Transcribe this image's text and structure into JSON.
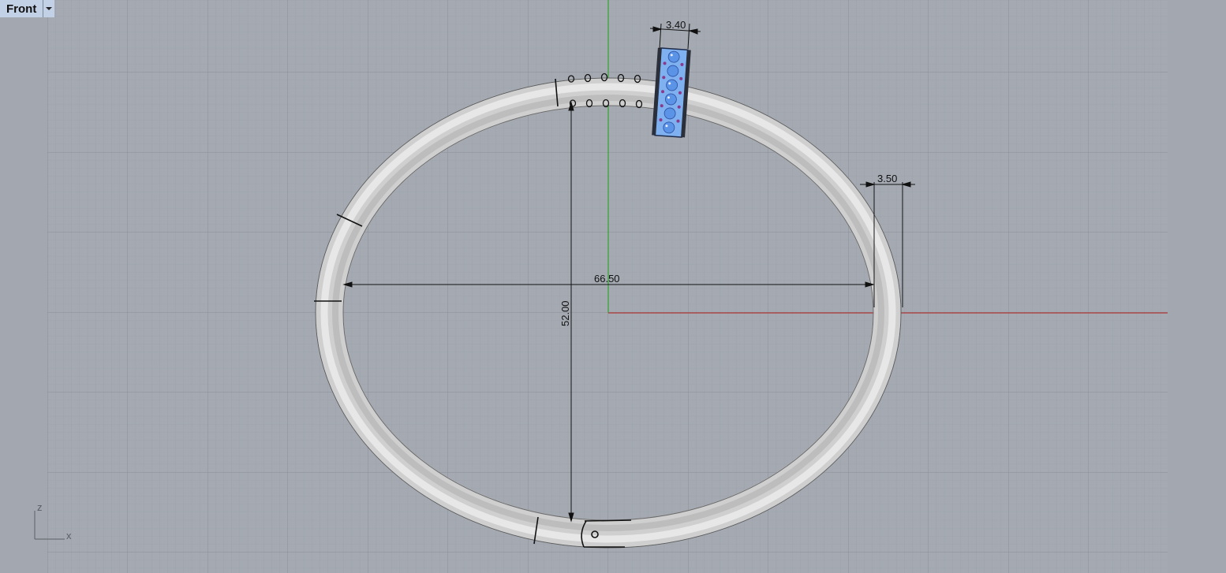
{
  "viewport": {
    "name": "Front",
    "background_color": "#a3a8b0",
    "grid_minor_color": "#989da5",
    "grid_major_color": "#8c9199",
    "x_axis_color": "#b03a3a",
    "z_axis_color": "#2fa52f"
  },
  "dimensions": {
    "width_label": "66.50",
    "height_label": "52.00",
    "thickness_label": "3.50",
    "stone_width_label": "3.40"
  },
  "axis_widget": {
    "vertical_label": "z",
    "horizontal_label": "x"
  },
  "model": {
    "tube_color": "#d4d4d4",
    "stone_color": "#7fb0f0"
  },
  "icons": {
    "dropdown": "chevron-down-icon"
  }
}
